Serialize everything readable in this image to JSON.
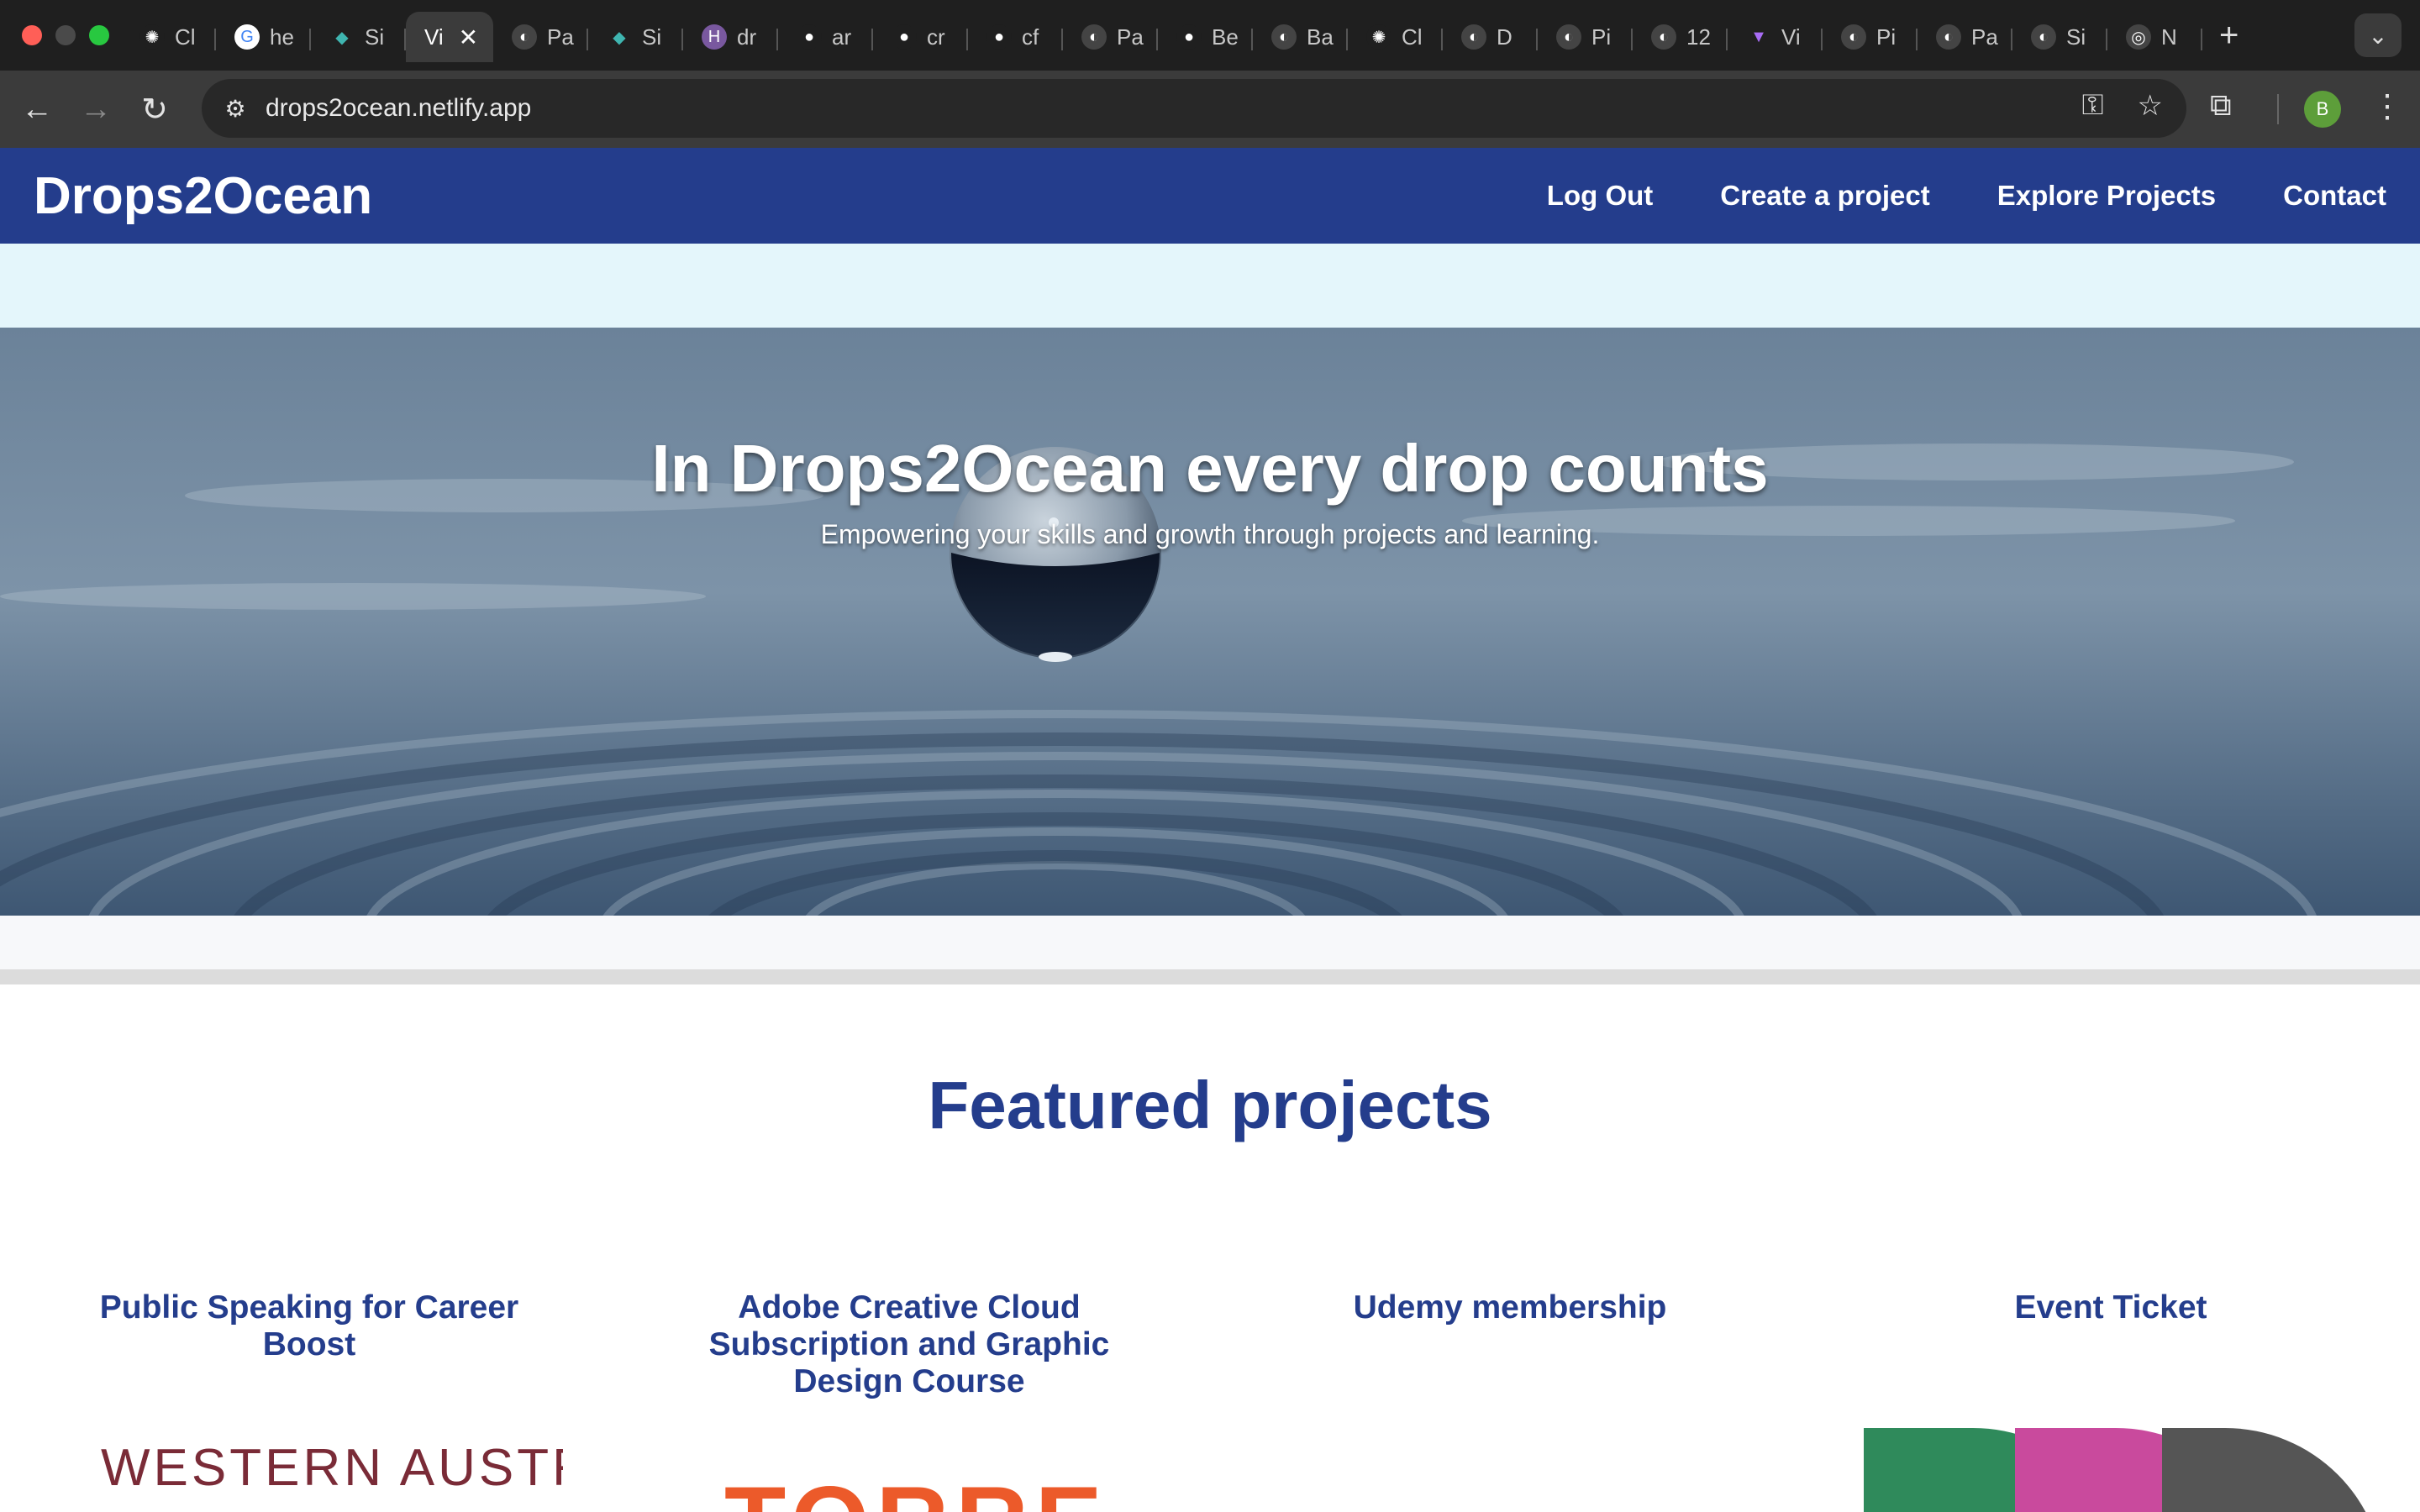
{
  "browser": {
    "tabs": [
      {
        "label": "Cl",
        "icon": "openai-icon"
      },
      {
        "label": "he",
        "icon": "google-icon"
      },
      {
        "label": "Si",
        "icon": "diamond-icon"
      },
      {
        "label": "Vi",
        "icon": "none",
        "active": true
      },
      {
        "label": "Pa",
        "icon": "globe-icon"
      },
      {
        "label": "Si",
        "icon": "diamond-icon"
      },
      {
        "label": "dr",
        "icon": "heroku-icon"
      },
      {
        "label": "ar",
        "icon": "github-icon"
      },
      {
        "label": "cr",
        "icon": "github-icon"
      },
      {
        "label": "cf",
        "icon": "github-icon"
      },
      {
        "label": "Pa",
        "icon": "globe-icon"
      },
      {
        "label": "Be",
        "icon": "github-icon"
      },
      {
        "label": "Ba",
        "icon": "globe-icon"
      },
      {
        "label": "Cl",
        "icon": "openai-icon"
      },
      {
        "label": "D",
        "icon": "globe-icon"
      },
      {
        "label": "Pi",
        "icon": "globe-icon"
      },
      {
        "label": "12",
        "icon": "globe-icon"
      },
      {
        "label": "Vi",
        "icon": "vite-icon"
      },
      {
        "label": "Pi",
        "icon": "globe-icon"
      },
      {
        "label": "Pa",
        "icon": "globe-icon"
      },
      {
        "label": "Si",
        "icon": "globe-icon"
      },
      {
        "label": "N",
        "icon": "chrome-icon"
      }
    ],
    "url": "drops2ocean.netlify.app",
    "profile_initial": "B"
  },
  "site": {
    "brand": "Drops2Ocean",
    "nav": {
      "logout": "Log Out",
      "create": "Create a project",
      "explore": "Explore Projects",
      "contact": "Contact"
    },
    "hero": {
      "title": "In Drops2Ocean every drop counts",
      "subtitle": "Empowering your skills and growth through projects and learning."
    },
    "featured_title": "Featured projects",
    "projects": [
      {
        "title": "Public Speaking for Career Boost",
        "image_text": "WESTERN AUSTR"
      },
      {
        "title": "Adobe Creative Cloud Subscription and Graphic Design Course",
        "image_text": "TORRE"
      },
      {
        "title": "Udemy membership",
        "image_text": ""
      },
      {
        "title": "Event Ticket",
        "image_text": ""
      }
    ]
  },
  "colors": {
    "brand_blue": "#243d8c",
    "band": "#e4f6fb",
    "chrome_bg": "#1f1f1f"
  }
}
